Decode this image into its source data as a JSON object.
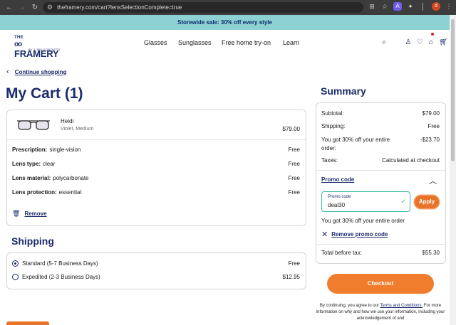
{
  "browser": {
    "url": "theframery.com/cart?lensSelectionComplete=true",
    "profile_initial": "d",
    "extension_initial": "A"
  },
  "promo_banner": "Storewide sale: 30% off every style",
  "header": {
    "logo_top": "THE",
    "logo_main": "FRAMERY",
    "logo_sub": "BY 1-800 CONTACTS",
    "nav": [
      "Glasses",
      "Sunglasses",
      "Free home try-on",
      "Learn"
    ]
  },
  "continue_shopping": "Continue shopping",
  "cart_title": "My Cart (1)",
  "product": {
    "name": "Heidi",
    "variant": "Violet, Medium",
    "price": "$79.00",
    "lines": [
      {
        "label": "Prescription:",
        "value": "single-vision",
        "price": "Free"
      },
      {
        "label": "Lens type:",
        "value": "clear",
        "price": "Free"
      },
      {
        "label": "Lens material:",
        "value": "polycarbonate",
        "price": "Free"
      },
      {
        "label": "Lens protection:",
        "value": "essential",
        "price": "Free"
      }
    ],
    "remove_label": "Remove"
  },
  "shipping": {
    "title": "Shipping",
    "options": [
      {
        "label": "Standard (5-7 Business Days)",
        "price": "Free",
        "selected": true
      },
      {
        "label": "Expedited (2-3 Business Days)",
        "price": "$12.95",
        "selected": false
      }
    ]
  },
  "summary": {
    "title": "Summary",
    "subtotal_label": "Subtotal:",
    "subtotal": "$79.00",
    "shipping_label": "Shipping:",
    "shipping": "Free",
    "discount_label_1": "You got 30% off your entire",
    "discount_label_2": "order:",
    "discount": "-$23.70",
    "taxes_label": "Taxes:",
    "taxes": "Calculated at checkout",
    "promo_title": "Promo code",
    "promo_field_label": "Promo code",
    "promo_value": "deal30",
    "apply_label": "Apply",
    "promo_message": "You got 30% off your entire order",
    "remove_promo": "Remove promo code",
    "total_label": "Total before tax:",
    "total": "$55.30",
    "checkout_label": "Checkout",
    "disclaimer_pre": "By continuing, you agree to our",
    "disclaimer_link": "Terms and Conditions.",
    "disclaimer_post": "For more information on why and how we use your information, including your acknowledgement of and"
  }
}
